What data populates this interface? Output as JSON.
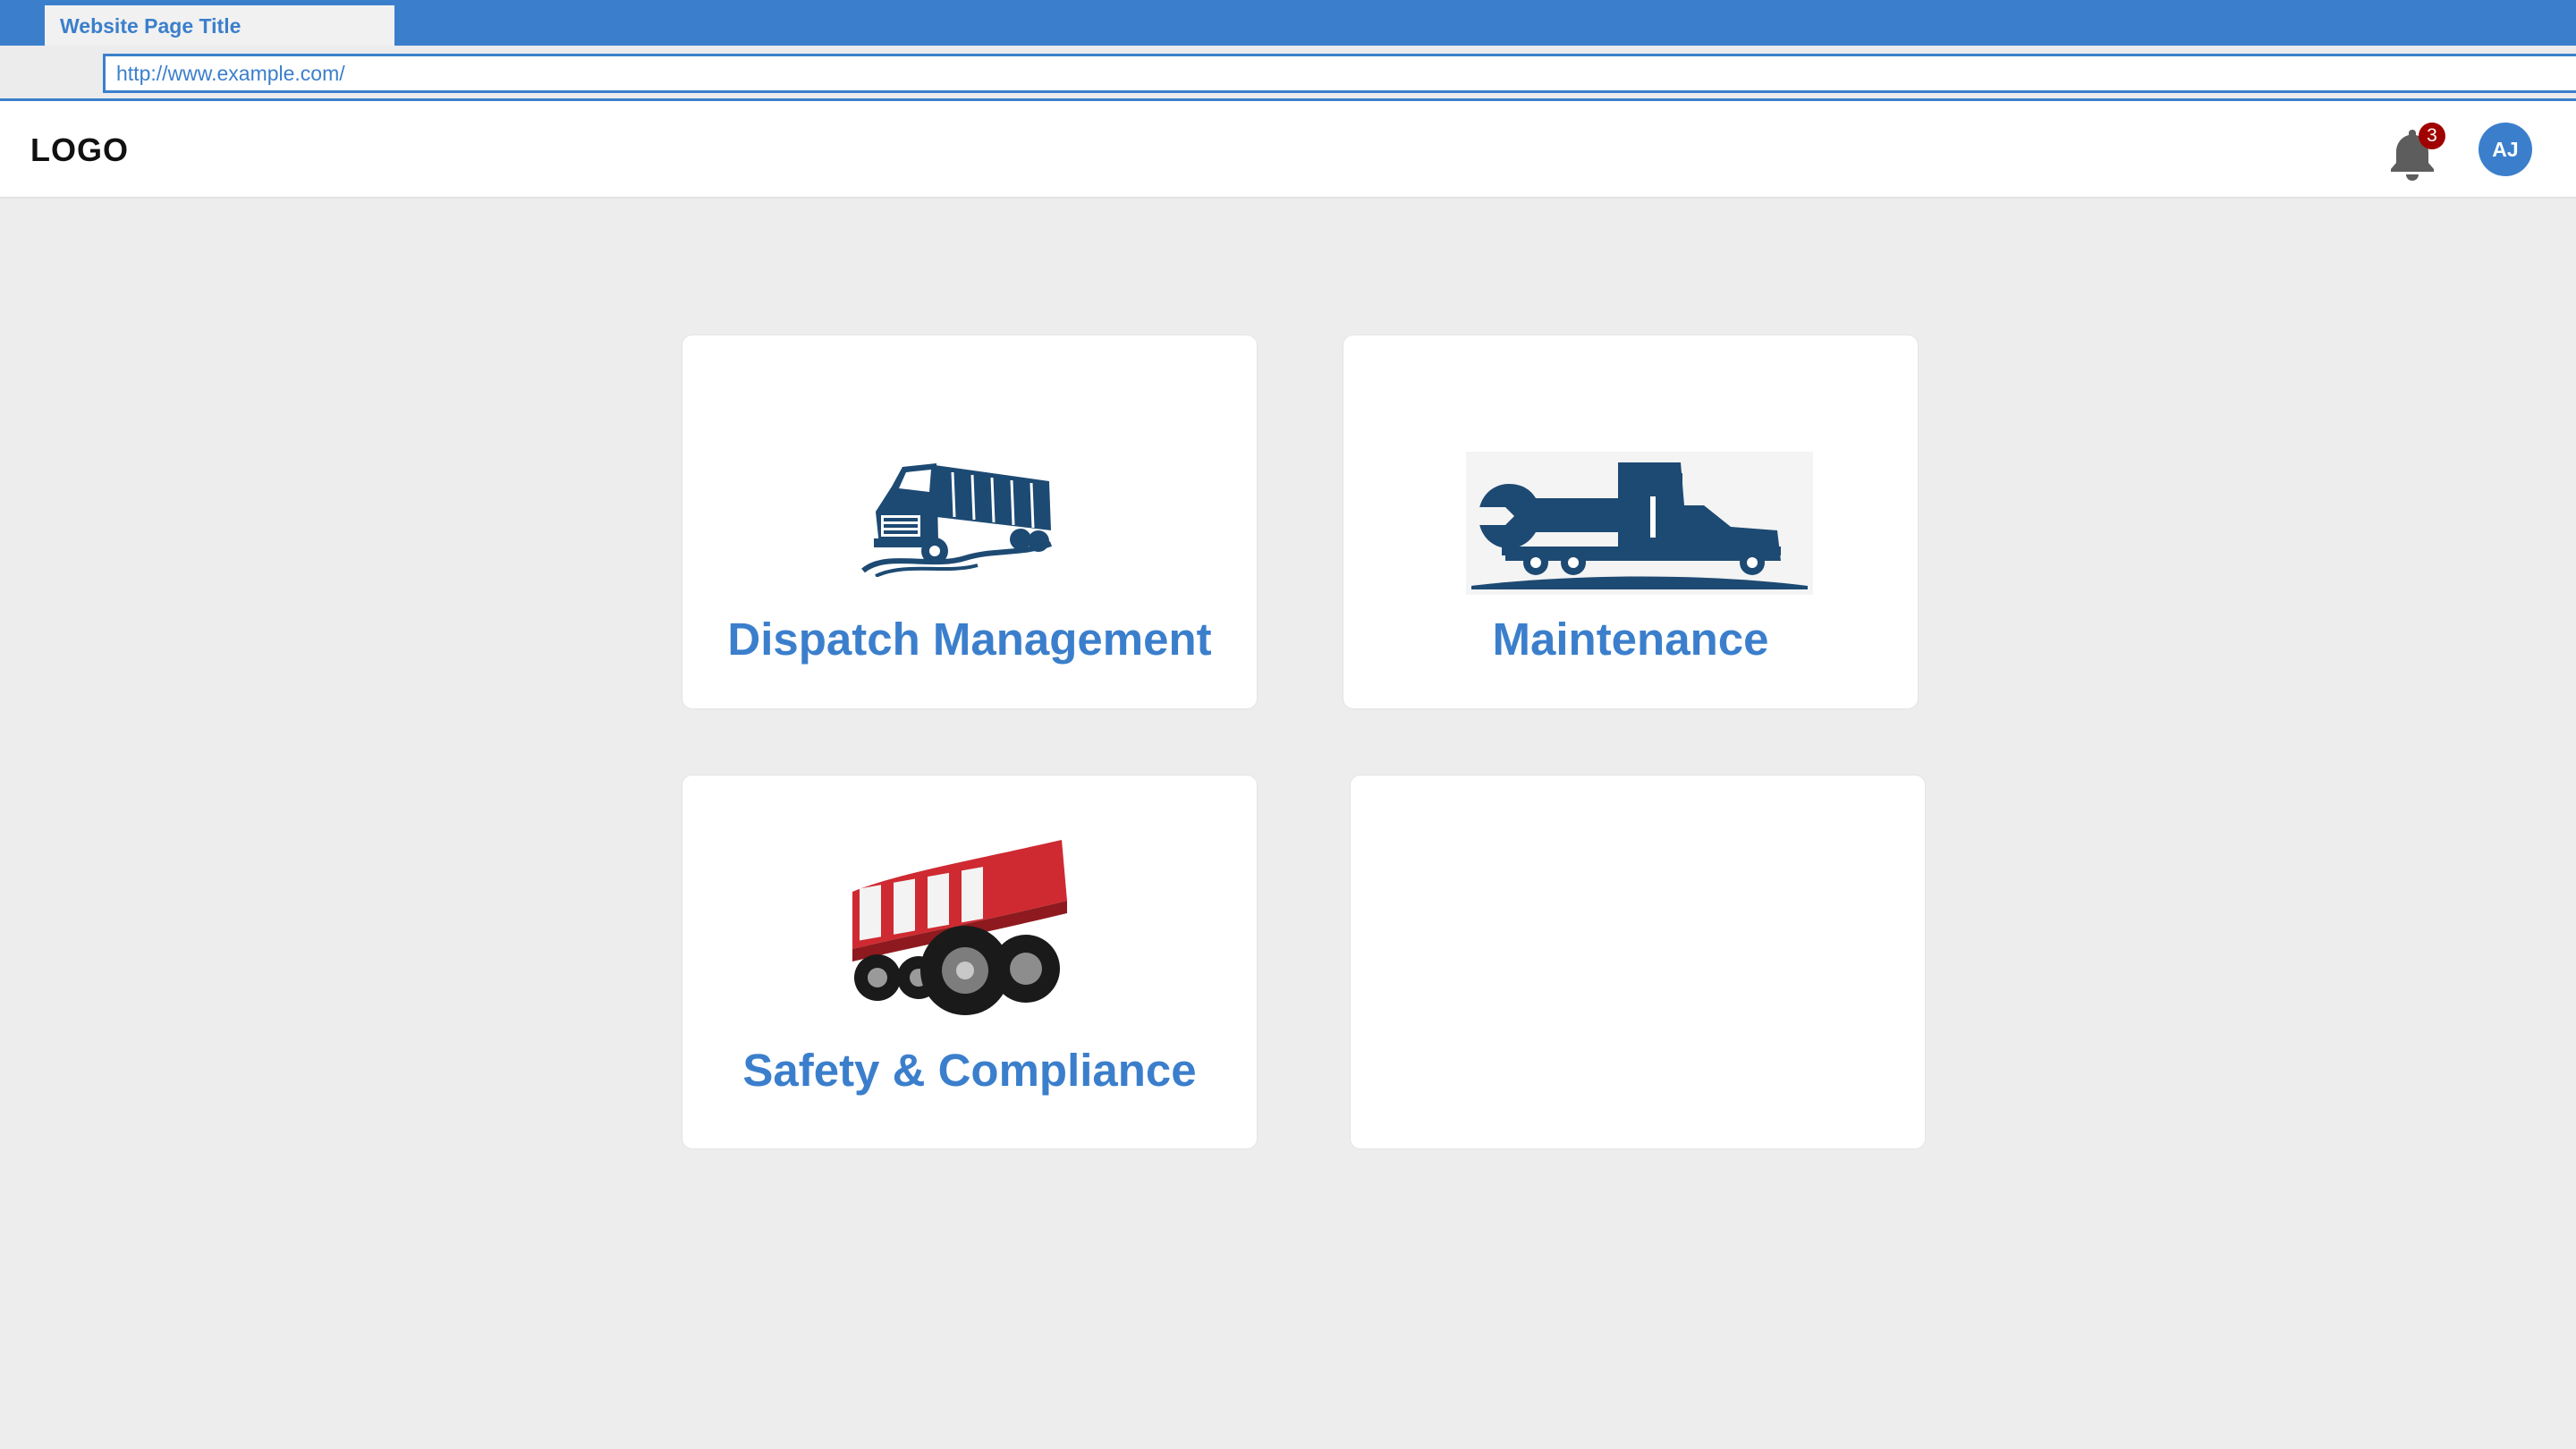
{
  "browser": {
    "tab_title": "Website Page Title",
    "url": "http://www.example.com/"
  },
  "header": {
    "logo": "LOGO",
    "notifications": {
      "icon": "bell-icon",
      "count": "3"
    },
    "user": {
      "initials": "AJ"
    }
  },
  "modules": [
    {
      "title": "Dispatch Management",
      "icon": "semi-truck-icon"
    },
    {
      "title": "Maintenance",
      "icon": "truck-wrench-icon"
    },
    {
      "title": "Safety & Compliance",
      "icon": "safety-wheels-icon"
    },
    {
      "title": "",
      "icon": ""
    }
  ],
  "colors": {
    "brand_blue": "#3b7fcc",
    "icon_navy": "#1d4a73",
    "badge_red": "#a00000",
    "safety_red": "#cf2a31",
    "background": "#ededed"
  }
}
